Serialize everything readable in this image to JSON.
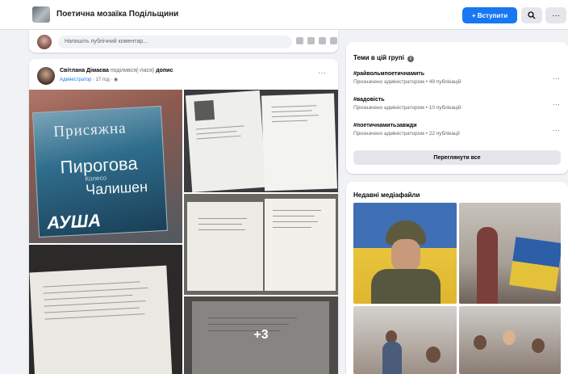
{
  "header": {
    "group_name": "Поетична мозаїка Подільщини",
    "join_label": "+ Вступити",
    "search_icon": "search-icon",
    "more_icon": "more-icon",
    "more_glyph": "···"
  },
  "composer": {
    "placeholder": "Напишіть публічний коментар..."
  },
  "post": {
    "author": "Світлана Дімаєва",
    "shared_text": "поділився(-лася)",
    "shared_target": "допис",
    "tag": "Адміністратор",
    "time": "· 17 год · ",
    "privacy_glyph": "◉",
    "more_glyph": "···",
    "book_title_1": "Присяжна",
    "book_title_2": "Пирогова",
    "book_title_3": "Колесо",
    "book_title_4": "Чалишен",
    "book_title_5": "АУША",
    "more_photos": "+3"
  },
  "topics": {
    "heading": "Теми в цій групі",
    "info_glyph": "i",
    "more_glyph": "···",
    "items": [
      {
        "name": "#райвольмпоетичнамить",
        "sub": "Призначено адміністратором • 49 публікацій"
      },
      {
        "name": "#вадовість",
        "sub": "Призначено адміністратором • 10 публікацій"
      },
      {
        "name": "#поетичнамитьзавжди",
        "sub": "Призначено адміністратором • 22 публікації"
      }
    ],
    "see_all": "Переглянути все"
  },
  "media": {
    "heading": "Недавні медіафайли"
  },
  "colors": {
    "accent": "#1877f2",
    "background": "#f0f2f5"
  }
}
